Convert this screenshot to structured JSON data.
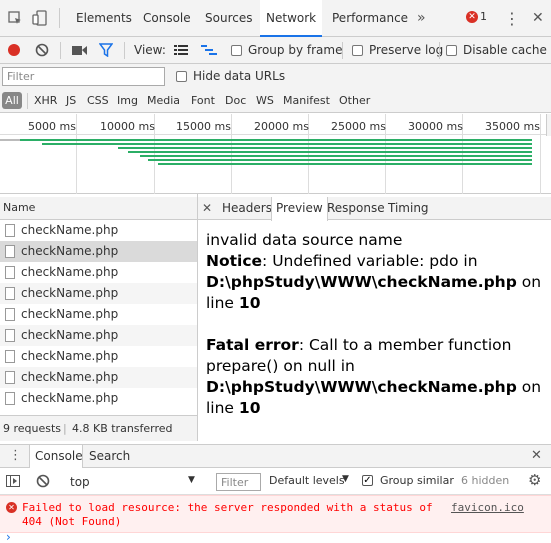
{
  "tabs": [
    {
      "label": "Elements"
    },
    {
      "label": "Console"
    },
    {
      "label": "Sources"
    },
    {
      "label": "Network",
      "active": true
    },
    {
      "label": "Performance"
    }
  ],
  "more_tabs": "»",
  "error_count": "1",
  "menu_icon": "⋮",
  "close_icon": "✕",
  "toolbar": {
    "view_label": "View:",
    "group_by_frame": "Group by frame",
    "preserve_log": "Preserve log",
    "disable_cache": "Disable cache"
  },
  "filter": {
    "placeholder": "Filter",
    "hide_data_urls": "Hide data URLs"
  },
  "types": [
    "All",
    "XHR",
    "JS",
    "CSS",
    "Img",
    "Media",
    "Font",
    "Doc",
    "WS",
    "Manifest",
    "Other"
  ],
  "timeline": {
    "ticks": [
      "5000 ms",
      "10000 ms",
      "15000 ms",
      "20000 ms",
      "25000 ms",
      "30000 ms",
      "35000 ms"
    ]
  },
  "requests": {
    "header": "Name",
    "items": [
      "checkName.php",
      "checkName.php",
      "checkName.php",
      "checkName.php",
      "checkName.php",
      "checkName.php",
      "checkName.php",
      "checkName.php",
      "checkName.php"
    ],
    "selected_index": 1,
    "summary_count": "9 requests",
    "summary_sep": "|",
    "summary_transfer": "4.8 KB transferred"
  },
  "detail": {
    "tabs": [
      "Headers",
      "Preview",
      "Response",
      "Timing"
    ],
    "active": "Preview",
    "line1": "invalid data source name",
    "notice_label": "Notice",
    "notice_text": ": Undefined variable: pdo in",
    "notice_path": "D:\\phpStudy\\WWW\\checkName.php",
    "on_word": " on",
    "line_word": "line ",
    "notice_line": "10",
    "fatal_label": "Fatal error",
    "fatal_text": ": Call to a member function",
    "fatal_text2": "prepare() on null in",
    "fatal_path": "D:\\phpStudy\\WWW\\checkName.php",
    "fatal_line": "10"
  },
  "drawer": {
    "tabs": [
      "Console",
      "Search"
    ],
    "active": "Console"
  },
  "console": {
    "context": "top",
    "filter_placeholder": "Filter",
    "levels": "Default levels",
    "group_similar": "Group similar",
    "hidden": "6 hidden",
    "error_message": "Failed to load resource: the server responded with a status of 404 (Not Found)",
    "error_source": "favicon.ico",
    "prompt": "›"
  },
  "colors": {
    "accent": "#1a73e8",
    "record": "#d93025",
    "error": "#ff0000",
    "bar": "#2bae66"
  }
}
